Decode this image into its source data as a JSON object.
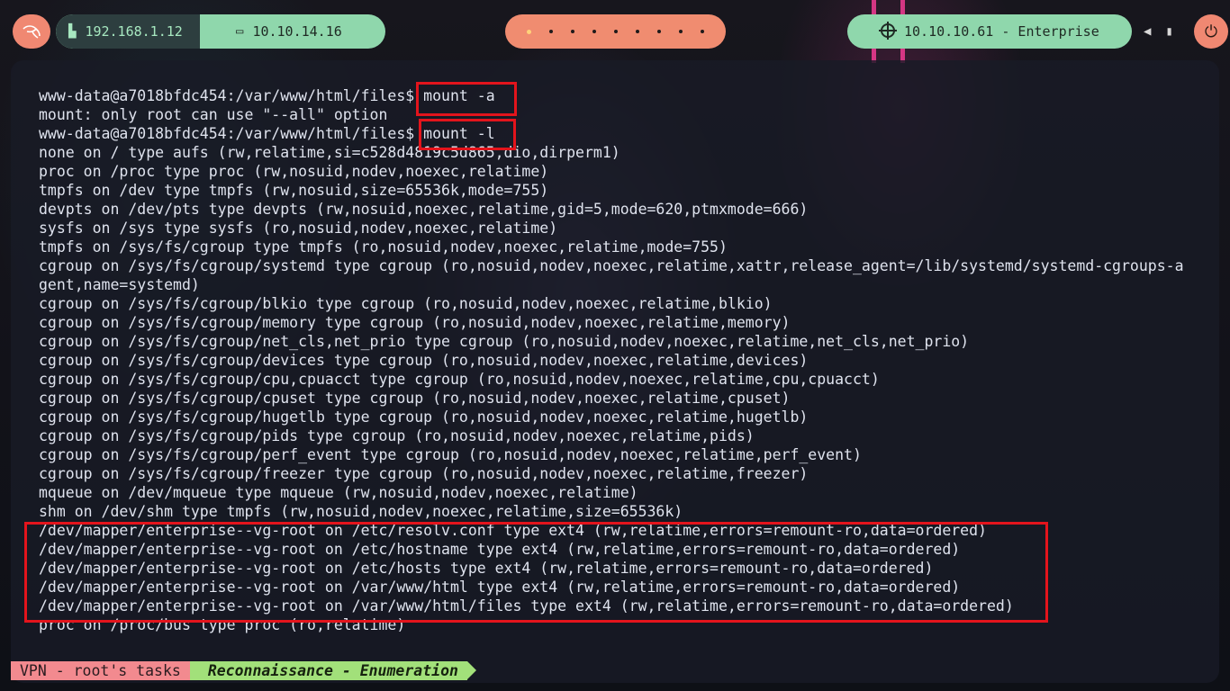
{
  "topbar": {
    "local_ip": "192.168.1.12",
    "vpn_ip": "10.10.14.16",
    "target": "10.10.10.61 - Enterprise",
    "workspace_count": 9,
    "active_workspace": 1
  },
  "terminal": {
    "lines": [
      "www-data@a7018bfdc454:/var/www/html/files$ mount -a",
      "mount: only root can use \"--all\" option",
      "www-data@a7018bfdc454:/var/www/html/files$ mount -l",
      "none on / type aufs (rw,relatime,si=c528d4819c5d865,dio,dirperm1)",
      "proc on /proc type proc (rw,nosuid,nodev,noexec,relatime)",
      "tmpfs on /dev type tmpfs (rw,nosuid,size=65536k,mode=755)",
      "devpts on /dev/pts type devpts (rw,nosuid,noexec,relatime,gid=5,mode=620,ptmxmode=666)",
      "sysfs on /sys type sysfs (ro,nosuid,nodev,noexec,relatime)",
      "tmpfs on /sys/fs/cgroup type tmpfs (ro,nosuid,nodev,noexec,relatime,mode=755)",
      "cgroup on /sys/fs/cgroup/systemd type cgroup (ro,nosuid,nodev,noexec,relatime,xattr,release_agent=/lib/systemd/systemd-cgroups-a",
      "gent,name=systemd)",
      "cgroup on /sys/fs/cgroup/blkio type cgroup (ro,nosuid,nodev,noexec,relatime,blkio)",
      "cgroup on /sys/fs/cgroup/memory type cgroup (ro,nosuid,nodev,noexec,relatime,memory)",
      "cgroup on /sys/fs/cgroup/net_cls,net_prio type cgroup (ro,nosuid,nodev,noexec,relatime,net_cls,net_prio)",
      "cgroup on /sys/fs/cgroup/devices type cgroup (ro,nosuid,nodev,noexec,relatime,devices)",
      "cgroup on /sys/fs/cgroup/cpu,cpuacct type cgroup (ro,nosuid,nodev,noexec,relatime,cpu,cpuacct)",
      "cgroup on /sys/fs/cgroup/cpuset type cgroup (ro,nosuid,nodev,noexec,relatime,cpuset)",
      "cgroup on /sys/fs/cgroup/hugetlb type cgroup (ro,nosuid,nodev,noexec,relatime,hugetlb)",
      "cgroup on /sys/fs/cgroup/pids type cgroup (ro,nosuid,nodev,noexec,relatime,pids)",
      "cgroup on /sys/fs/cgroup/perf_event type cgroup (ro,nosuid,nodev,noexec,relatime,perf_event)",
      "cgroup on /sys/fs/cgroup/freezer type cgroup (ro,nosuid,nodev,noexec,relatime,freezer)",
      "mqueue on /dev/mqueue type mqueue (rw,nosuid,nodev,noexec,relatime)",
      "shm on /dev/shm type tmpfs (rw,nosuid,nodev,noexec,relatime,size=65536k)",
      "/dev/mapper/enterprise--vg-root on /etc/resolv.conf type ext4 (rw,relatime,errors=remount-ro,data=ordered)",
      "/dev/mapper/enterprise--vg-root on /etc/hostname type ext4 (rw,relatime,errors=remount-ro,data=ordered)",
      "/dev/mapper/enterprise--vg-root on /etc/hosts type ext4 (rw,relatime,errors=remount-ro,data=ordered)",
      "/dev/mapper/enterprise--vg-root on /var/www/html type ext4 (rw,relatime,errors=remount-ro,data=ordered)",
      "/dev/mapper/enterprise--vg-root on /var/www/html/files type ext4 (rw,relatime,errors=remount-ro,data=ordered)",
      "proc on /proc/bus type proc (ro,relatime)"
    ]
  },
  "statusbar": {
    "session": "VPN - root's tasks",
    "window": "Reconnaissance - Enumeration"
  },
  "colors": {
    "accent_green": "#8fd7ac",
    "accent_orange": "#f08872",
    "highlight_red": "#e3141c"
  }
}
